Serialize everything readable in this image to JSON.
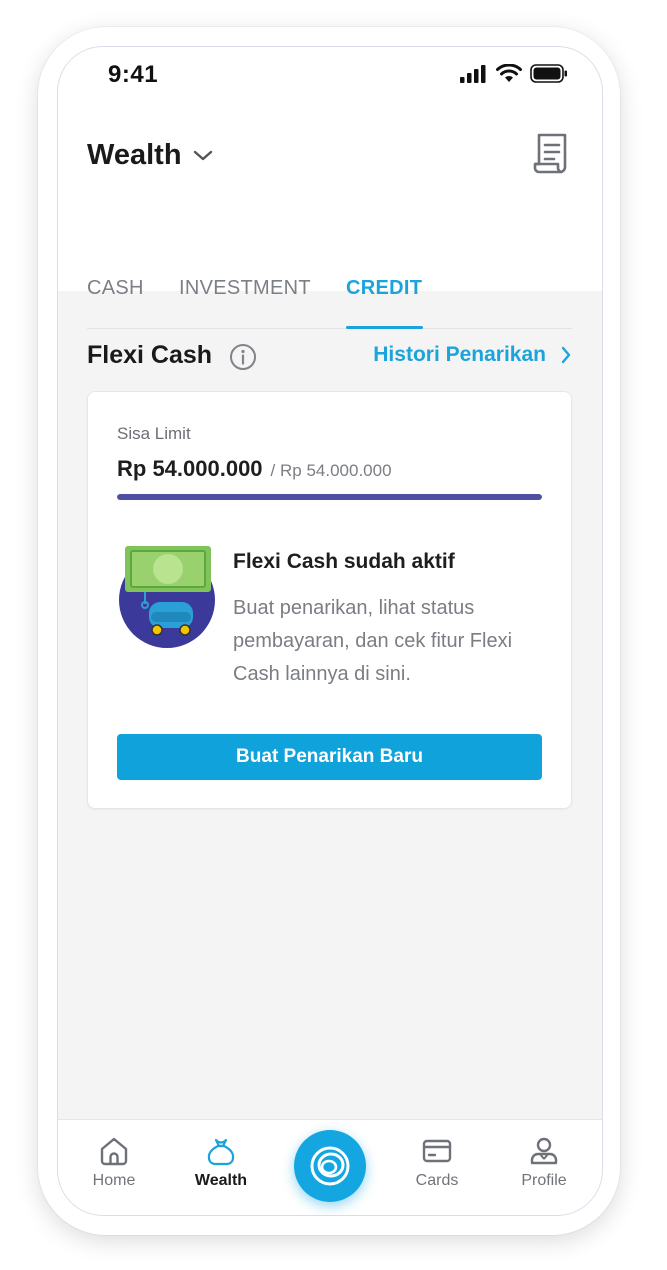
{
  "status_bar": {
    "time": "9:41"
  },
  "header": {
    "title": "Wealth",
    "tabs": [
      {
        "label": "CASH",
        "active": false
      },
      {
        "label": "INVESTMENT",
        "active": false
      },
      {
        "label": "CREDIT",
        "active": true
      }
    ]
  },
  "section": {
    "title": "Flexi Cash",
    "history_link": "Histori Penarikan"
  },
  "card": {
    "limit_label": "Sisa Limit",
    "limit_value": "Rp 54.000.000",
    "limit_total": "/ Rp 54.000.000",
    "remaining_fraction": 1.0,
    "message_title": "Flexi Cash sudah aktif",
    "message_body": "Buat penarikan, lihat status pembayaran, dan cek fitur Flexi Cash lainnya di sini.",
    "cta_label": "Buat Penarikan Baru"
  },
  "bottom_nav": {
    "items": [
      {
        "label": "Home",
        "icon": "home-icon",
        "active": false
      },
      {
        "label": "Wealth",
        "icon": "money-bag-icon",
        "active": true
      },
      {
        "label": "Cards",
        "icon": "card-icon",
        "active": false
      },
      {
        "label": "Profile",
        "icon": "profile-icon",
        "active": false
      }
    ]
  },
  "colors": {
    "accent": "#1ba4db",
    "progress": "#4d4fa3",
    "background": "#f4f4f4"
  }
}
